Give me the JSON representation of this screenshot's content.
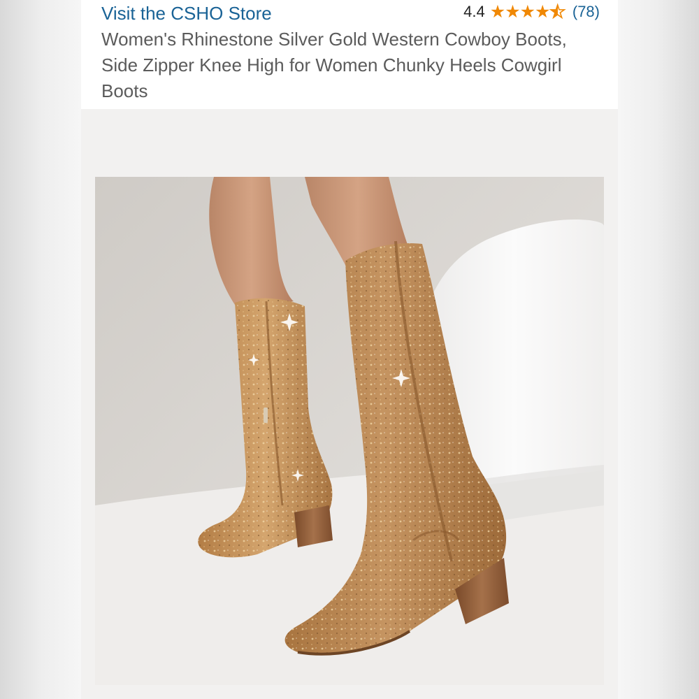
{
  "store": {
    "link_label": "Visit the CSHO Store"
  },
  "rating": {
    "value_label": "4.4",
    "value": 4.4,
    "max": 5,
    "count_label": "(78)",
    "star_color": "#f08804"
  },
  "product": {
    "title": "Women's Rhinestone Silver Gold Western Cowboy Boots, Side Zipper Knee High for Women Chunky Heels Cowgirl Boots"
  },
  "colors": {
    "link": "#1a6396",
    "title_text": "#5b5b5b",
    "boot_tan": "#b4824f"
  }
}
